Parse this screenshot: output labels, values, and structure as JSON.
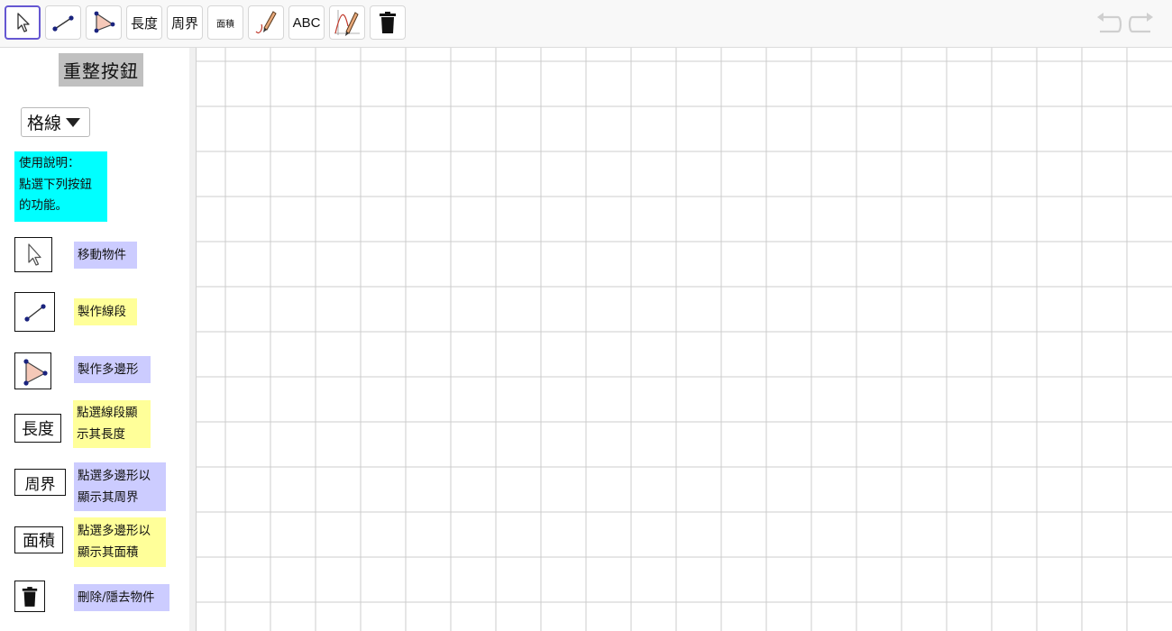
{
  "colors": {
    "accent": "#6557d2",
    "note_bg": "#00ffff",
    "label_lavender": "#ccccff",
    "label_yellow": "#ffff99",
    "reset_bg": "#c0c0c0",
    "polygon_fill": "#f5c8b8",
    "point": "#1a237e",
    "grid": "#cccccc"
  },
  "toolbar": {
    "tools": [
      {
        "name": "move-tool",
        "icon": "cursor-arrow-icon",
        "active": true
      },
      {
        "name": "segment-tool",
        "icon": "segment-icon"
      },
      {
        "name": "polygon-tool",
        "icon": "polygon-icon"
      },
      {
        "name": "length-tool",
        "label": "長度"
      },
      {
        "name": "perimeter-tool",
        "label": "周界"
      },
      {
        "name": "area-tool",
        "label": "面積"
      },
      {
        "name": "pen-tool",
        "icon": "pen-icon"
      },
      {
        "name": "text-tool",
        "label": "ABC"
      },
      {
        "name": "function-pen-tool",
        "icon": "function-pen-icon"
      },
      {
        "name": "delete-tool",
        "icon": "trash-icon"
      }
    ],
    "undo_icon": "undo-icon",
    "redo_icon": "redo-icon"
  },
  "sidebar": {
    "reset_button": "重整按鈕",
    "grid_dropdown": {
      "selected": "格線"
    },
    "instructions": [
      "使用說明：",
      "點選下列按鈕",
      "的功能。"
    ],
    "items": [
      {
        "icon": "cursor-arrow-icon",
        "lines": [
          "移動物件"
        ]
      },
      {
        "icon": "segment-icon",
        "lines": [
          "製作線段"
        ]
      },
      {
        "icon": "polygon-icon",
        "lines": [
          "製作多邊形"
        ]
      },
      {
        "icon_text": "長度",
        "lines": [
          "點選線段顯",
          "示其長度"
        ]
      },
      {
        "icon_text": "周界",
        "lines": [
          "點選多邊形以",
          "顯示其周界"
        ]
      },
      {
        "icon_text": "面積",
        "lines": [
          "點選多邊形以",
          "顯示其面積"
        ]
      },
      {
        "icon": "trash-icon",
        "lines": [
          "刪除/隱去物件"
        ]
      }
    ]
  }
}
